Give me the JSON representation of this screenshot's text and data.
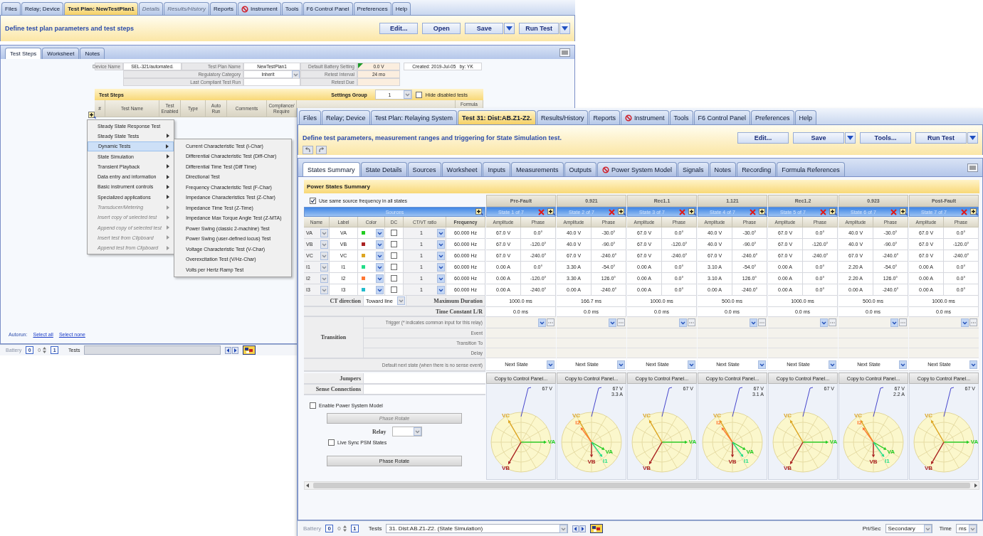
{
  "back_window": {
    "menu_tabs": [
      {
        "label": "Files",
        "selected": false,
        "disabled": false,
        "kind": "plain"
      },
      {
        "label": "Relay; Device",
        "selected": false,
        "disabled": false,
        "kind": "plain"
      },
      {
        "label": "Test Plan: NewTestPlan1",
        "selected": true,
        "disabled": false,
        "kind": "plain"
      },
      {
        "label": "Details",
        "selected": false,
        "disabled": true,
        "kind": "plain"
      },
      {
        "label": "Results/History",
        "selected": false,
        "disabled": true,
        "kind": "plain"
      },
      {
        "label": "Reports",
        "selected": false,
        "disabled": false,
        "kind": "plain"
      },
      {
        "label": "Instrument",
        "selected": false,
        "disabled": false,
        "kind": "blocked"
      },
      {
        "label": "Tools",
        "selected": false,
        "disabled": false,
        "kind": "plain"
      },
      {
        "label": "F6 Control Panel",
        "selected": false,
        "disabled": false,
        "kind": "plain"
      },
      {
        "label": "Preferences",
        "selected": false,
        "disabled": false,
        "kind": "plain"
      },
      {
        "label": "Help",
        "selected": false,
        "disabled": false,
        "kind": "plain"
      }
    ],
    "instruction": "Define test plan parameters and test steps",
    "buttons": [
      {
        "label": "Edit...",
        "kind": "plain"
      },
      {
        "label": "Open",
        "kind": "plain"
      },
      {
        "label": "Save",
        "kind": "split"
      },
      {
        "label": "Run Test",
        "kind": "split"
      }
    ],
    "tabs": [
      {
        "label": "Test Steps",
        "selected": true
      },
      {
        "label": "Worksheet",
        "selected": false
      },
      {
        "label": "Notes",
        "selected": false
      }
    ],
    "plan_rows": [
      [
        {
          "label": "Device Name",
          "value": "SEL-321/automated.",
          "kind": "text"
        },
        {
          "label": "Test Plan Name",
          "value": "NewTestPlan1",
          "kind": "text"
        },
        {
          "label": "Default Battery Setting",
          "value": "0.0 V",
          "kind": "flagged"
        }
      ],
      [
        {
          "label": "Regulatory Category",
          "value": "Inherit",
          "kind": "dropdown"
        },
        {
          "label": "Retest Interval",
          "value": "24 mo",
          "kind": "shaded"
        }
      ],
      [
        {
          "label": "Last Compliant Test Run",
          "kind": "text"
        },
        {
          "label": "Retest Due",
          "kind": "shaded"
        }
      ]
    ],
    "created": "Created: 2019-Jul-05   by: YK",
    "test_steps": {
      "title": "Test Steps",
      "settings_group_label": "Settings Group",
      "settings_group": "1",
      "hide_disabled": {
        "label": "Hide disabled tests",
        "checked": false
      },
      "columns": [
        "#",
        "Test Name",
        "Test Enabled",
        "Type",
        "Auto Run",
        "Comments",
        "Compliance/ Require",
        "Formula"
      ]
    },
    "add_menu": [
      {
        "label": "Steady State Response Test",
        "submenu": false,
        "disabled": false,
        "selected": false
      },
      {
        "label": "Steady State Tests",
        "submenu": true,
        "disabled": false,
        "selected": false
      },
      {
        "label": "Dynamic Tests",
        "submenu": true,
        "disabled": false,
        "selected": true
      },
      {
        "label": "State Simulation",
        "submenu": true,
        "disabled": false,
        "selected": false
      },
      {
        "label": "Transient Playback",
        "submenu": true,
        "disabled": false,
        "selected": false
      },
      {
        "label": "Data entry and information",
        "submenu": true,
        "disabled": false,
        "selected": false
      },
      {
        "label": "Basic instrument controls",
        "submenu": true,
        "disabled": false,
        "selected": false
      },
      {
        "label": "Specialized applications",
        "submenu": true,
        "disabled": false,
        "selected": false
      },
      {
        "label": "Transducer/Metering",
        "submenu": true,
        "disabled": true,
        "selected": false
      },
      {
        "label": "Insert copy of selected test",
        "submenu": true,
        "disabled": true,
        "selected": false
      },
      {
        "label": "Append copy of selected test",
        "submenu": true,
        "disabled": true,
        "selected": false
      },
      {
        "label": "Insert test from Clipboard",
        "submenu": true,
        "disabled": true,
        "selected": false
      },
      {
        "label": "Append test from Clipboard",
        "submenu": true,
        "disabled": true,
        "selected": false
      }
    ],
    "submenu": [
      "Current Characteristic Test (I-Char)",
      "Differential Characteristic Test (Diff-Char)",
      "Differential Time Test (Diff Time)",
      "Directional Test",
      "Frequency Characteristic Test (F-Char)",
      "Impedance Characteristics Test (Z-Char)",
      "Impedance Time Test (Z-Time)",
      "Impedance Max Torque Angle Test (Z-MTA)",
      "Power Swing (classic 2-machine) Test",
      "Power Swing (user-defined locus) Test",
      "Voltage Characteristic Test (V-Char)",
      "Overexcitation Test (V/Hz-Char)",
      "Volts per Hertz Ramp Test"
    ],
    "autorun": {
      "label": "Autorun:",
      "links": [
        "Select all",
        "Select none"
      ]
    },
    "status_bar": {
      "battery_label": "Battery",
      "battery": "0",
      "step": "0",
      "count": "1",
      "tests_label": "Tests"
    }
  },
  "front_window": {
    "menu_tabs": [
      {
        "label": "Files",
        "selected": false,
        "kind": "plain"
      },
      {
        "label": "Relay; Device",
        "selected": false,
        "kind": "plain"
      },
      {
        "label": "Test Plan: Relaying System",
        "selected": false,
        "kind": "plain"
      },
      {
        "label": "Test 31: Dist:AB.Z1-Z2.",
        "selected": true,
        "kind": "plain"
      },
      {
        "label": "Results/History",
        "selected": false,
        "kind": "plain"
      },
      {
        "label": "Reports",
        "selected": false,
        "kind": "plain"
      },
      {
        "label": "Instrument",
        "selected": false,
        "kind": "blocked"
      },
      {
        "label": "Tools",
        "selected": false,
        "kind": "plain"
      },
      {
        "label": "F6 Control Panel",
        "selected": false,
        "kind": "plain"
      },
      {
        "label": "Preferences",
        "selected": false,
        "kind": "plain"
      },
      {
        "label": "Help",
        "selected": false,
        "kind": "plain"
      }
    ],
    "instruction": "Define test parameters, measurement ranges and triggering for State Simulation test.",
    "buttons": [
      {
        "label": "Edit...",
        "kind": "plain"
      },
      {
        "label": "Save",
        "kind": "split"
      },
      {
        "label": "Tools...",
        "kind": "plain"
      },
      {
        "label": "Run Test",
        "kind": "split"
      }
    ],
    "tabs": [
      {
        "label": "States Summary",
        "selected": true,
        "kind": "plain"
      },
      {
        "label": "State Details",
        "selected": false,
        "kind": "plain"
      },
      {
        "label": "Sources",
        "selected": false,
        "kind": "plain"
      },
      {
        "label": "Worksheet",
        "selected": false,
        "kind": "plain"
      },
      {
        "label": "Inputs",
        "selected": false,
        "kind": "plain"
      },
      {
        "label": "Measurements",
        "selected": false,
        "kind": "plain"
      },
      {
        "label": "Outputs",
        "selected": false,
        "kind": "plain"
      },
      {
        "label": "Power System Model",
        "selected": false,
        "kind": "blocked"
      },
      {
        "label": "Signals",
        "selected": false,
        "kind": "plain"
      },
      {
        "label": "Notes",
        "selected": false,
        "kind": "plain"
      },
      {
        "label": "Recording",
        "selected": false,
        "kind": "plain"
      },
      {
        "label": "Formula References",
        "selected": false,
        "kind": "plain"
      }
    ],
    "summary_title": "Power States Summary",
    "same_frequency": {
      "label": "Use same source frequency in all states",
      "checked": true
    },
    "sources": {
      "title": "Sources",
      "columns": [
        "Name",
        "Label",
        "Color",
        "DC",
        "CT/VT ratio",
        "Frequency"
      ],
      "rows": [
        {
          "name": "VA",
          "label": "VA",
          "color": "#22cc22",
          "dc": false,
          "ratio": "1",
          "frequency": "60.000 Hz",
          "kind": "voltage"
        },
        {
          "name": "VB",
          "label": "VB",
          "color": "#aa2222",
          "dc": false,
          "ratio": "1",
          "frequency": "60.000 Hz",
          "kind": "voltage"
        },
        {
          "name": "VC",
          "label": "VC",
          "color": "#dda522",
          "dc": false,
          "ratio": "1",
          "frequency": "60.000 Hz",
          "kind": "voltage"
        },
        {
          "name": "I1",
          "label": "I1",
          "color": "#22dd88",
          "dc": false,
          "ratio": "1",
          "frequency": "60.000 Hz",
          "kind": "current"
        },
        {
          "name": "I2",
          "label": "I2",
          "color": "#ff7733",
          "dc": false,
          "ratio": "1",
          "frequency": "60.000 Hz",
          "kind": "current"
        },
        {
          "name": "I3",
          "label": "I3",
          "color": "#22bbcc",
          "dc": false,
          "ratio": "1",
          "frequency": "60.000 Hz",
          "kind": "current"
        }
      ]
    },
    "ct_direction": {
      "label": "CT direction",
      "value": "Toward line"
    },
    "labels": {
      "max_duration": "Maximum Duration",
      "time_constant": "Time Constant L/R",
      "transition": "Transition",
      "trigger": "Trigger (* indicates common input for this relay)",
      "event": "Event",
      "transition_to": "Transition To",
      "delay": "Delay",
      "default_next": "Default next state (when there is no sense event)",
      "jumpers": "Jumpers",
      "sense": "Sense Connections"
    },
    "psm": {
      "enable": {
        "label": "Enable Power System Model",
        "checked": false
      },
      "phase_rotate_top": {
        "label": "Phase Rotate",
        "disabled": true
      },
      "relay": "Relay",
      "live_sync": {
        "label": "Live Sync PSM States",
        "checked": false
      },
      "phase_rotate": {
        "label": "Phase Rotate",
        "disabled": false
      }
    },
    "states": [
      {
        "name": "Pre-Fault",
        "index": "State 1 of 7",
        "headers": [
          "Amplitude",
          "Phase"
        ],
        "values": [
          [
            "67.0 V",
            "0.0°"
          ],
          [
            "67.0 V",
            "-120.0°"
          ],
          [
            "67.0 V",
            "-240.0°"
          ],
          [
            "0.00 A",
            "0.0°"
          ],
          [
            "0.00 A",
            "-120.0°"
          ],
          [
            "0.00 A",
            "-240.0°"
          ]
        ],
        "max_duration": "1000.0 ms",
        "time_constant": "0.0 ms",
        "next_state": "Next State",
        "copy": "Copy to Control Panel...",
        "readings": [
          "67 V"
        ],
        "phasor_labels": [
          "VA",
          "VB",
          "VC"
        ]
      },
      {
        "name": "0.921",
        "index": "State 2 of 7",
        "headers": [
          "Amplitude",
          "Phase"
        ],
        "values": [
          [
            "40.0 V",
            "-30.0°"
          ],
          [
            "40.0 V",
            "-90.0°"
          ],
          [
            "67.0 V",
            "-240.0°"
          ],
          [
            "3.30 A",
            "-54.0°"
          ],
          [
            "3.30 A",
            "126.0°"
          ],
          [
            "0.00 A",
            "-240.0°"
          ]
        ],
        "max_duration": "166.7 ms",
        "time_constant": "0.0 ms",
        "next_state": "Next State",
        "copy": "Copy to Control Panel...",
        "readings": [
          "67 V",
          "3.3 A"
        ],
        "phasor_labels": [
          "VA",
          "VB",
          "VC",
          "I1",
          "I2"
        ]
      },
      {
        "name": "Rec1.1",
        "index": "State 3 of 7",
        "headers": [
          "Amplitude",
          "Phase"
        ],
        "values": [
          [
            "67.0 V",
            "0.0°"
          ],
          [
            "67.0 V",
            "-120.0°"
          ],
          [
            "67.0 V",
            "-240.0°"
          ],
          [
            "0.00 A",
            "0.0°"
          ],
          [
            "0.00 A",
            "0.0°"
          ],
          [
            "0.00 A",
            "0.0°"
          ]
        ],
        "max_duration": "1000.0 ms",
        "time_constant": "0.0 ms",
        "next_state": "Next State",
        "copy": "Copy to Control Panel...",
        "readings": [
          "67 V"
        ],
        "phasor_labels": [
          "VA",
          "VB",
          "VC"
        ]
      },
      {
        "name": "1.121",
        "index": "State 4 of 7",
        "headers": [
          "Amplitude",
          "Phase"
        ],
        "values": [
          [
            "40.0 V",
            "-30.0°"
          ],
          [
            "40.0 V",
            "-90.0°"
          ],
          [
            "67.0 V",
            "-240.0°"
          ],
          [
            "3.10 A",
            "-54.0°"
          ],
          [
            "3.10 A",
            "126.0°"
          ],
          [
            "0.00 A",
            "-240.0°"
          ]
        ],
        "max_duration": "500.0 ms",
        "time_constant": "0.0 ms",
        "next_state": "Next State",
        "copy": "Copy to Control Panel...",
        "readings": [
          "67 V",
          "3.1 A"
        ],
        "phasor_labels": [
          "VA",
          "VB",
          "VC",
          "I1",
          "I2"
        ]
      },
      {
        "name": "Rec1.2",
        "index": "State 5 of 7",
        "headers": [
          "Amplitude",
          "Phase"
        ],
        "values": [
          [
            "67.0 V",
            "0.0°"
          ],
          [
            "67.0 V",
            "-120.0°"
          ],
          [
            "67.0 V",
            "-240.0°"
          ],
          [
            "0.00 A",
            "0.0°"
          ],
          [
            "0.00 A",
            "0.0°"
          ],
          [
            "0.00 A",
            "0.0°"
          ]
        ],
        "max_duration": "1000.0 ms",
        "time_constant": "0.0 ms",
        "next_state": "Next State",
        "copy": "Copy to Control Panel...",
        "readings": [
          "67 V"
        ],
        "phasor_labels": [
          "VA",
          "VB",
          "VC"
        ]
      },
      {
        "name": "0.923",
        "index": "State 6 of 7",
        "headers": [
          "Amplitude",
          "Phase"
        ],
        "values": [
          [
            "40.0 V",
            "-30.0°"
          ],
          [
            "40.0 V",
            "-90.0°"
          ],
          [
            "67.0 V",
            "-240.0°"
          ],
          [
            "2.20 A",
            "-54.0°"
          ],
          [
            "2.20 A",
            "126.0°"
          ],
          [
            "0.00 A",
            "-240.0°"
          ]
        ],
        "max_duration": "500.0 ms",
        "time_constant": "0.0 ms",
        "next_state": "Next State",
        "copy": "Copy to Control Panel...",
        "readings": [
          "67 V",
          "2.2 A"
        ],
        "phasor_labels": [
          "VA",
          "VB",
          "VC",
          "I1",
          "I2"
        ]
      },
      {
        "name": "Post-Fault",
        "index": "State 7 of 7",
        "headers": [
          "Amplitude",
          "Phase"
        ],
        "values": [
          [
            "67.0 V",
            "0.0°"
          ],
          [
            "67.0 V",
            "-120.0°"
          ],
          [
            "67.0 V",
            "-240.0°"
          ],
          [
            "0.00 A",
            "0.0°"
          ],
          [
            "0.00 A",
            "0.0°"
          ],
          [
            "0.00 A",
            "0.0°"
          ]
        ],
        "max_duration": "1000.0 ms",
        "time_constant": "0.0 ms",
        "next_state": "Next State",
        "copy": "Copy to Control Panel...",
        "readings": [
          "67 V"
        ],
        "phasor_labels": [
          "VA",
          "VB",
          "VC"
        ]
      }
    ],
    "status_bar": {
      "battery_label": "Battery",
      "battery": "0",
      "step": "0",
      "count": "1",
      "tests_label": "Tests",
      "tests_value": "31. Dist:AB.Z1-Z2. (State Simulation)",
      "pri_sec_label": "Pri/Sec",
      "pri_sec": "Secondary",
      "time_label": "Time",
      "time": "ms"
    }
  }
}
